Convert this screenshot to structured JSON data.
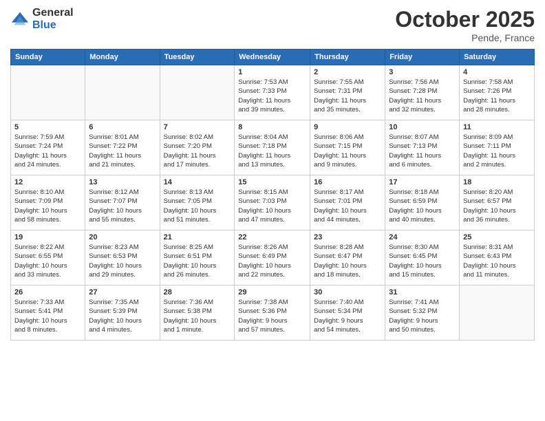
{
  "header": {
    "logo_general": "General",
    "logo_blue": "Blue",
    "month": "October 2025",
    "location": "Pende, France"
  },
  "days_of_week": [
    "Sunday",
    "Monday",
    "Tuesday",
    "Wednesday",
    "Thursday",
    "Friday",
    "Saturday"
  ],
  "weeks": [
    [
      {
        "day": "",
        "info": ""
      },
      {
        "day": "",
        "info": ""
      },
      {
        "day": "",
        "info": ""
      },
      {
        "day": "1",
        "info": "Sunrise: 7:53 AM\nSunset: 7:33 PM\nDaylight: 11 hours\nand 39 minutes."
      },
      {
        "day": "2",
        "info": "Sunrise: 7:55 AM\nSunset: 7:31 PM\nDaylight: 11 hours\nand 35 minutes."
      },
      {
        "day": "3",
        "info": "Sunrise: 7:56 AM\nSunset: 7:28 PM\nDaylight: 11 hours\nand 32 minutes."
      },
      {
        "day": "4",
        "info": "Sunrise: 7:58 AM\nSunset: 7:26 PM\nDaylight: 11 hours\nand 28 minutes."
      }
    ],
    [
      {
        "day": "5",
        "info": "Sunrise: 7:59 AM\nSunset: 7:24 PM\nDaylight: 11 hours\nand 24 minutes."
      },
      {
        "day": "6",
        "info": "Sunrise: 8:01 AM\nSunset: 7:22 PM\nDaylight: 11 hours\nand 21 minutes."
      },
      {
        "day": "7",
        "info": "Sunrise: 8:02 AM\nSunset: 7:20 PM\nDaylight: 11 hours\nand 17 minutes."
      },
      {
        "day": "8",
        "info": "Sunrise: 8:04 AM\nSunset: 7:18 PM\nDaylight: 11 hours\nand 13 minutes."
      },
      {
        "day": "9",
        "info": "Sunrise: 8:06 AM\nSunset: 7:15 PM\nDaylight: 11 hours\nand 9 minutes."
      },
      {
        "day": "10",
        "info": "Sunrise: 8:07 AM\nSunset: 7:13 PM\nDaylight: 11 hours\nand 6 minutes."
      },
      {
        "day": "11",
        "info": "Sunrise: 8:09 AM\nSunset: 7:11 PM\nDaylight: 11 hours\nand 2 minutes."
      }
    ],
    [
      {
        "day": "12",
        "info": "Sunrise: 8:10 AM\nSunset: 7:09 PM\nDaylight: 10 hours\nand 58 minutes."
      },
      {
        "day": "13",
        "info": "Sunrise: 8:12 AM\nSunset: 7:07 PM\nDaylight: 10 hours\nand 55 minutes."
      },
      {
        "day": "14",
        "info": "Sunrise: 8:13 AM\nSunset: 7:05 PM\nDaylight: 10 hours\nand 51 minutes."
      },
      {
        "day": "15",
        "info": "Sunrise: 8:15 AM\nSunset: 7:03 PM\nDaylight: 10 hours\nand 47 minutes."
      },
      {
        "day": "16",
        "info": "Sunrise: 8:17 AM\nSunset: 7:01 PM\nDaylight: 10 hours\nand 44 minutes."
      },
      {
        "day": "17",
        "info": "Sunrise: 8:18 AM\nSunset: 6:59 PM\nDaylight: 10 hours\nand 40 minutes."
      },
      {
        "day": "18",
        "info": "Sunrise: 8:20 AM\nSunset: 6:57 PM\nDaylight: 10 hours\nand 36 minutes."
      }
    ],
    [
      {
        "day": "19",
        "info": "Sunrise: 8:22 AM\nSunset: 6:55 PM\nDaylight: 10 hours\nand 33 minutes."
      },
      {
        "day": "20",
        "info": "Sunrise: 8:23 AM\nSunset: 6:53 PM\nDaylight: 10 hours\nand 29 minutes."
      },
      {
        "day": "21",
        "info": "Sunrise: 8:25 AM\nSunset: 6:51 PM\nDaylight: 10 hours\nand 26 minutes."
      },
      {
        "day": "22",
        "info": "Sunrise: 8:26 AM\nSunset: 6:49 PM\nDaylight: 10 hours\nand 22 minutes."
      },
      {
        "day": "23",
        "info": "Sunrise: 8:28 AM\nSunset: 6:47 PM\nDaylight: 10 hours\nand 18 minutes."
      },
      {
        "day": "24",
        "info": "Sunrise: 8:30 AM\nSunset: 6:45 PM\nDaylight: 10 hours\nand 15 minutes."
      },
      {
        "day": "25",
        "info": "Sunrise: 8:31 AM\nSunset: 6:43 PM\nDaylight: 10 hours\nand 11 minutes."
      }
    ],
    [
      {
        "day": "26",
        "info": "Sunrise: 7:33 AM\nSunset: 5:41 PM\nDaylight: 10 hours\nand 8 minutes."
      },
      {
        "day": "27",
        "info": "Sunrise: 7:35 AM\nSunset: 5:39 PM\nDaylight: 10 hours\nand 4 minutes."
      },
      {
        "day": "28",
        "info": "Sunrise: 7:36 AM\nSunset: 5:38 PM\nDaylight: 10 hours\nand 1 minute."
      },
      {
        "day": "29",
        "info": "Sunrise: 7:38 AM\nSunset: 5:36 PM\nDaylight: 9 hours\nand 57 minutes."
      },
      {
        "day": "30",
        "info": "Sunrise: 7:40 AM\nSunset: 5:34 PM\nDaylight: 9 hours\nand 54 minutes."
      },
      {
        "day": "31",
        "info": "Sunrise: 7:41 AM\nSunset: 5:32 PM\nDaylight: 9 hours\nand 50 minutes."
      },
      {
        "day": "",
        "info": ""
      }
    ]
  ]
}
